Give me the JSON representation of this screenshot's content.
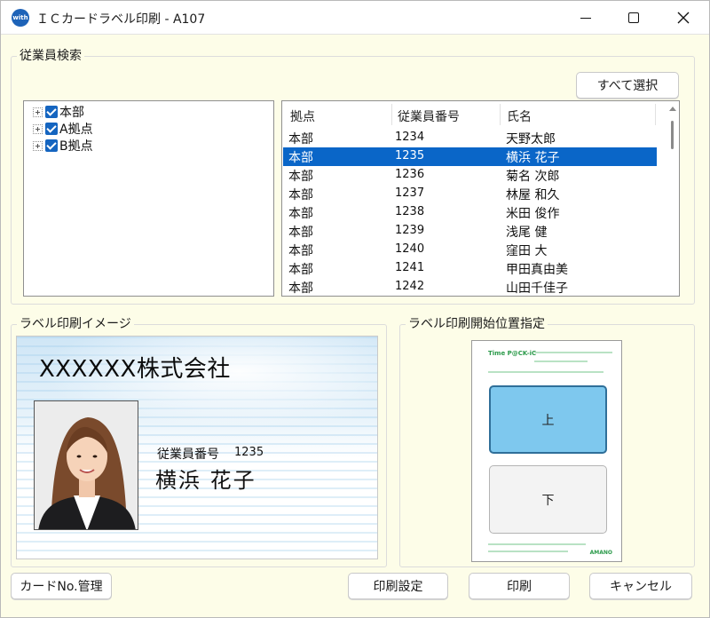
{
  "window": {
    "app_icon_text": "with",
    "title": "ＩＣカードラベル印刷 - A107"
  },
  "search_group": {
    "label": "従業員検索",
    "select_all_label": "すべて選択",
    "tree": [
      {
        "label": "本部"
      },
      {
        "label": "A拠点"
      },
      {
        "label": "B拠点"
      }
    ],
    "columns": [
      "拠点",
      "従業員番号",
      "氏名"
    ],
    "rows": [
      {
        "base": "本部",
        "number": "1234",
        "name": "天野太郎"
      },
      {
        "base": "本部",
        "number": "1235",
        "name": "横浜 花子"
      },
      {
        "base": "本部",
        "number": "1236",
        "name": "菊名 次郎"
      },
      {
        "base": "本部",
        "number": "1237",
        "name": "林屋 和久"
      },
      {
        "base": "本部",
        "number": "1238",
        "name": "米田 俊作"
      },
      {
        "base": "本部",
        "number": "1239",
        "name": "浅尾 健"
      },
      {
        "base": "本部",
        "number": "1240",
        "name": "窪田 大"
      },
      {
        "base": "本部",
        "number": "1241",
        "name": "甲田真由美"
      },
      {
        "base": "本部",
        "number": "1242",
        "name": "山田千佳子"
      }
    ]
  },
  "preview_group": {
    "label": "ラベル印刷イメージ",
    "company": "XXXXXX株式会社",
    "employee_number_label": "従業員番号",
    "employee_number": "1235",
    "employee_name": "横浜 花子"
  },
  "position_group": {
    "label": "ラベル印刷開始位置指定",
    "sheet_logo": "Time P@CK-iC",
    "sheet_brand": "AMANO",
    "top_label": "上",
    "bottom_label": "下"
  },
  "buttons": {
    "card_no": "カードNo.管理",
    "print_settings": "印刷設定",
    "print": "印刷",
    "cancel": "キャンセル"
  },
  "colors": {
    "selection": "#0a66c8",
    "checkbox": "#1565c0",
    "window_bg": "#fdfde8",
    "selected_slot": "#7ec8ee"
  }
}
